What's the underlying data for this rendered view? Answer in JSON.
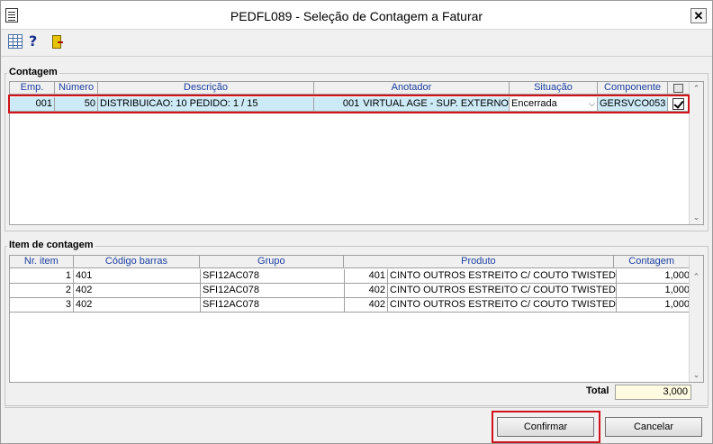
{
  "window": {
    "title": "PEDFL089 - Seleção de Contagem a Faturar",
    "close_label": "✕"
  },
  "toolbar": {
    "icons": [
      "grid-icon",
      "help-icon",
      "exit-icon"
    ],
    "help_label": "?"
  },
  "contagem": {
    "label": "Contagem",
    "columns": [
      "Emp.",
      "Número",
      "Descrição",
      "Anotador",
      "Situação",
      "Componente"
    ],
    "rows": [
      {
        "emp": "001",
        "numero": "50",
        "descricao": "DISTRIBUICAO: 10 PEDIDO: 1 / 15",
        "anotador_code": "001",
        "anotador_name": "VIRTUAL AGE - SUP. EXTERNO",
        "situacao": "Encerrada",
        "componente": "GERSVCO053",
        "checked": true
      }
    ]
  },
  "item_contagem": {
    "label": "Item de contagem",
    "columns": [
      "Nr. item",
      "Código barras",
      "Grupo",
      "Produto",
      "Contagem"
    ],
    "rows": [
      {
        "nr": "1",
        "codigo": "401",
        "grupo": "SFI12AC078",
        "produto_code": "401",
        "produto_name": "CINTO OUTROS ESTREITO C/ COUTO TWISTED",
        "contagem": "1,000"
      },
      {
        "nr": "2",
        "codigo": "402",
        "grupo": "SFI12AC078",
        "produto_code": "402",
        "produto_name": "CINTO OUTROS ESTREITO C/ COUTO TWISTED",
        "contagem": "1,000"
      },
      {
        "nr": "3",
        "codigo": "402",
        "grupo": "SFI12AC078",
        "produto_code": "402",
        "produto_name": "CINTO OUTROS ESTREITO C/ COUTO TWISTED",
        "contagem": "1,000"
      }
    ],
    "total_label": "Total",
    "total_value": "3,000"
  },
  "buttons": {
    "confirm_label": "Confirmar",
    "cancel_label": "Cancelar"
  },
  "colors": {
    "header_text": "#1a3ea0",
    "selected_row": "#cdeaf7",
    "highlight": "#d0121b",
    "total_field": "#fffbe0"
  }
}
